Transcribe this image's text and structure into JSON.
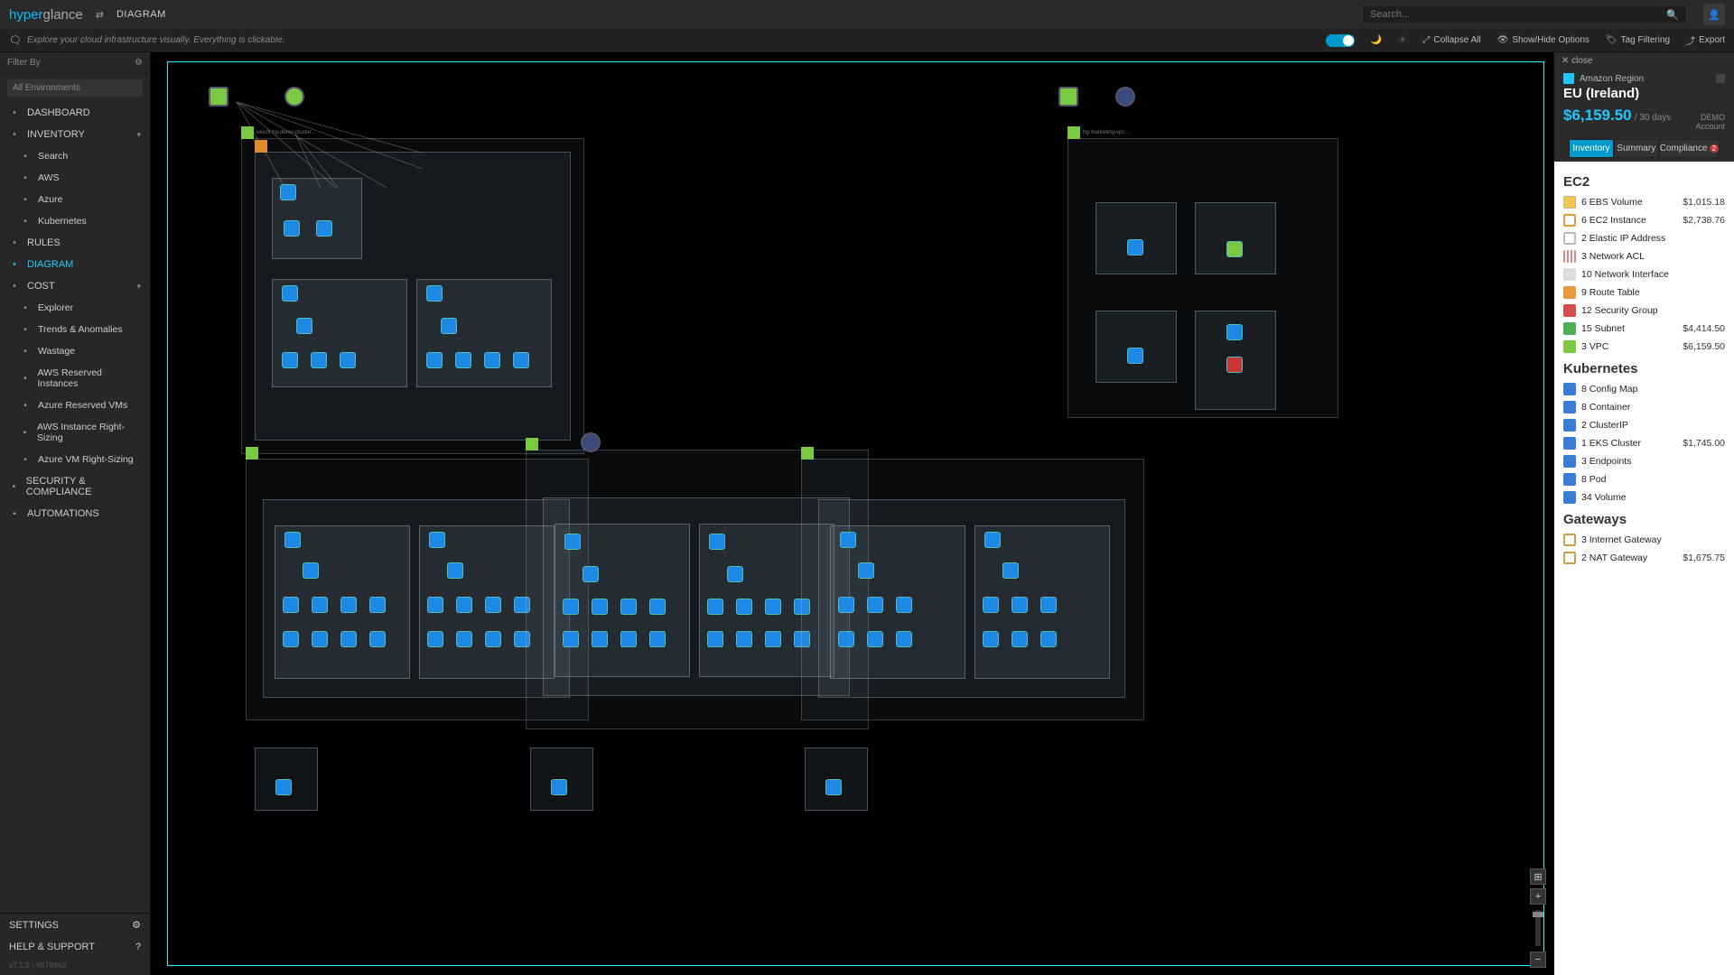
{
  "header": {
    "logo1": "hyper",
    "logo2": "glance",
    "breadcrumb": "DIAGRAM",
    "search_placeholder": "Search..."
  },
  "toolbar": {
    "hint": "Explore your cloud infrastructure visually. Everything is clickable.",
    "collapse": "Collapse All",
    "showhide": "Show/Hide Options",
    "tagfilter": "Tag Filtering",
    "export": "Export"
  },
  "sidebar": {
    "filter_label": "Filter By",
    "env_placeholder": "All Environments",
    "items": [
      {
        "label": "DASHBOARD",
        "icon": "gauge"
      },
      {
        "label": "INVENTORY",
        "icon": "list",
        "expand": true
      },
      {
        "label": "Search",
        "icon": "search",
        "sub": true
      },
      {
        "label": "AWS",
        "icon": "aws",
        "sub": true
      },
      {
        "label": "Azure",
        "icon": "azure",
        "sub": true
      },
      {
        "label": "Kubernetes",
        "icon": "k8s",
        "sub": true
      },
      {
        "label": "RULES",
        "icon": "shield"
      },
      {
        "label": "DIAGRAM",
        "icon": "branch",
        "active": true
      },
      {
        "label": "COST",
        "icon": "dollar",
        "expand": true
      },
      {
        "label": "Explorer",
        "icon": "compass",
        "sub": true
      },
      {
        "label": "Trends & Anomalies",
        "icon": "trend",
        "sub": true
      },
      {
        "label": "Wastage",
        "icon": "trash",
        "sub": true
      },
      {
        "label": "AWS Reserved Instances",
        "icon": "ri",
        "sub": true
      },
      {
        "label": "Azure Reserved VMs",
        "icon": "ri",
        "sub": true
      },
      {
        "label": "AWS Instance Right-Sizing",
        "icon": "rs",
        "sub": true
      },
      {
        "label": "Azure VM Right-Sizing",
        "icon": "rs",
        "sub": true
      },
      {
        "label": "SECURITY & COMPLIANCE",
        "icon": "lock"
      },
      {
        "label": "AUTOMATIONS",
        "icon": "dots"
      }
    ],
    "settings": "SETTINGS",
    "help": "HELP & SUPPORT",
    "version": "v7.1.5  |  8578963"
  },
  "rpanel": {
    "close": "close",
    "chip": "Amazon Region",
    "title": "EU (Ireland)",
    "cost": "$6,159.50",
    "per": "/ 30 days",
    "acct1": "DEMO",
    "acct2": "Account",
    "tabs": {
      "inventory": "Inventory",
      "summary": "Summary",
      "compliance": "Compliance",
      "badge": "2"
    },
    "sections": [
      {
        "title": "EC2",
        "rows": [
          {
            "ic": "ic-vol",
            "label": "6 EBS Volume",
            "val": "$1,015.18"
          },
          {
            "ic": "ic-ec2",
            "label": "6 EC2 Instance",
            "val": "$2,738.76"
          },
          {
            "ic": "ic-eip",
            "label": "2 Elastic IP Address",
            "val": ""
          },
          {
            "ic": "ic-acl",
            "label": "3 Network ACL",
            "val": ""
          },
          {
            "ic": "ic-ni",
            "label": "10 Network Interface",
            "val": ""
          },
          {
            "ic": "ic-rt",
            "label": "9 Route Table",
            "val": ""
          },
          {
            "ic": "ic-sg",
            "label": "12 Security Group",
            "val": ""
          },
          {
            "ic": "ic-sub",
            "label": "15 Subnet",
            "val": "$4,414.50"
          },
          {
            "ic": "ic-vpc",
            "label": "3 VPC",
            "val": "$6,159.50"
          }
        ]
      },
      {
        "title": "Kubernetes",
        "rows": [
          {
            "ic": "ic-k8",
            "label": "8 Config Map",
            "val": ""
          },
          {
            "ic": "ic-k8",
            "label": "8 Container",
            "val": ""
          },
          {
            "ic": "ic-k8",
            "label": "2 ClusterIP",
            "val": ""
          },
          {
            "ic": "ic-k8",
            "label": "1 EKS Cluster",
            "val": "$1,745.00"
          },
          {
            "ic": "ic-k8",
            "label": "3 Endpoints",
            "val": ""
          },
          {
            "ic": "ic-k8",
            "label": "8 Pod",
            "val": ""
          },
          {
            "ic": "ic-k8",
            "label": "34 Volume",
            "val": ""
          }
        ]
      },
      {
        "title": "Gateways",
        "rows": [
          {
            "ic": "ic-gw",
            "label": "3 Internet Gateway",
            "val": ""
          },
          {
            "ic": "ic-gw",
            "label": "2 NAT Gateway",
            "val": "$1,675.75"
          }
        ]
      }
    ]
  }
}
